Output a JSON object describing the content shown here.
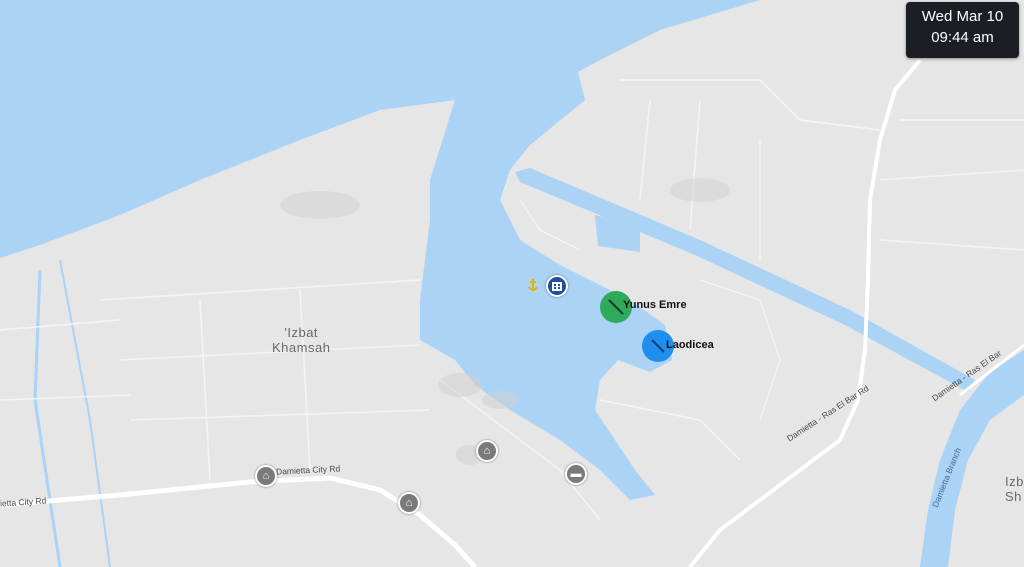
{
  "clock": {
    "day": "Wed Mar 10",
    "time": "09:44 am"
  },
  "places": {
    "town_1": "'Izbat",
    "town_2": "Khamsah",
    "edge_town_1": "Izb",
    "edge_town_2": "Sh"
  },
  "roads": {
    "city_rd_1": "Damietta City Rd",
    "city_rd_2": "ietta City Rd",
    "ras_el_bar_1": "Damietta - Ras El Bar Rd",
    "ras_el_bar_2": "Damietta - Ras El Bar",
    "branch": "Damietta Branch"
  },
  "vessels": [
    {
      "name": "Yunus Emre",
      "color": "#2eaa5a"
    },
    {
      "name": "Laodicea",
      "color": "#1e8fee"
    }
  ],
  "icons": {
    "anchorage": "anchor-icon",
    "port": "port-building-icon",
    "shop_1": "basket-icon",
    "shop_2": "basket-icon",
    "shop_3": "basket-icon",
    "truck": "truck-icon"
  },
  "colors": {
    "water": "#aad3f5",
    "land": "#e6e6e6",
    "roads": "#ffffff"
  }
}
